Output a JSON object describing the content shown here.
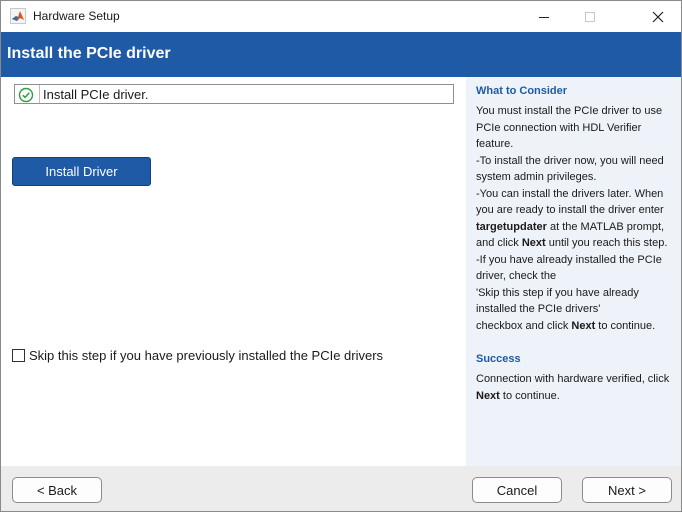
{
  "window": {
    "title": "Hardware Setup",
    "app_icon": "matlab-icon",
    "controls": {
      "minimize_icon": "minimize-icon",
      "maximize_icon": "maximize-icon",
      "close_icon": "close-icon"
    }
  },
  "header": {
    "title": "Install the PCIe driver",
    "background_color": "#1f5aa6"
  },
  "main": {
    "status": {
      "icon": "check-circle-icon",
      "icon_color": "#2e9e3e",
      "text": "Install PCIe driver."
    },
    "install_button_label": "Install Driver",
    "skip_checkbox": {
      "checked": false,
      "label": "Skip this step if you have previously installed the PCIe drivers"
    }
  },
  "side_panel": {
    "consider_heading": "What to Consider",
    "consider_lines": [
      [
        "You must install the PCIe driver to use"
      ],
      [
        "PCIe connection with HDL Verifier"
      ],
      [
        "feature."
      ],
      [
        " -To install the driver now, you will need"
      ],
      [
        "system admin privileges."
      ],
      [
        " -You can install the drivers later. When"
      ],
      [
        "you are ready to install the driver enter"
      ],
      [
        "",
        "targetupdater",
        " at the MATLAB prompt,"
      ],
      [
        "  and click ",
        "Next",
        " until you reach this step."
      ],
      [
        " -If you have already installed the PCIe"
      ],
      [
        "driver, check the"
      ],
      [
        "'Skip this step if you have already"
      ],
      [
        "installed the PCIe drivers'"
      ],
      [
        " checkbox and click ",
        "Next",
        " to continue."
      ]
    ],
    "success_heading": "Success",
    "success_lines": [
      [
        "Connection with hardware verified, click"
      ],
      [
        "",
        "Next",
        " to continue."
      ]
    ]
  },
  "footer": {
    "back_label": "< Back",
    "cancel_label": "Cancel",
    "next_label": "Next >"
  }
}
